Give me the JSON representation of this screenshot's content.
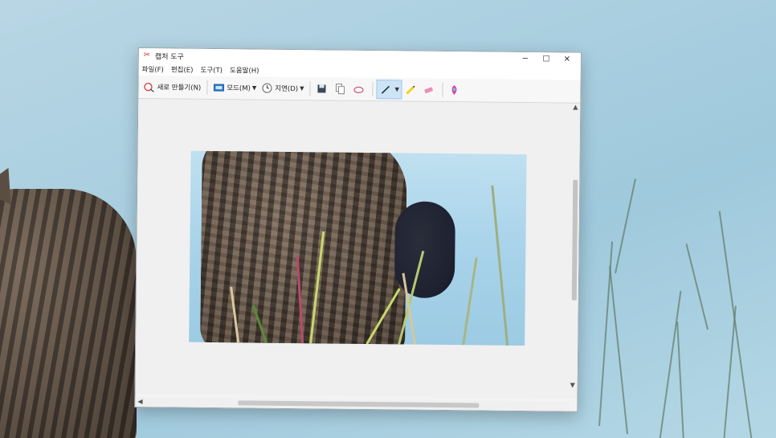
{
  "window": {
    "title": "캡처 도구",
    "controls": {
      "minimize": "─",
      "maximize": "☐",
      "close": "✕"
    }
  },
  "menu": [
    "파일(F)",
    "편집(E)",
    "도구(T)",
    "도움말(H)"
  ],
  "toolbar": {
    "new_label": "새로 만들기(N)",
    "mode_label": "모드(M)",
    "delay_label": "지연(D)"
  },
  "icons": {
    "app": "scissors-icon",
    "new": "new-snip-icon",
    "mode": "mode-icon",
    "delay": "clock-icon",
    "save": "save-icon",
    "copy": "copy-icon",
    "send": "send-icon",
    "pen": "pen-icon",
    "highlighter": "highlighter-icon",
    "eraser": "eraser-icon",
    "paint3d": "paint3d-icon"
  },
  "colors": {
    "pen_active_bg": "#cde4f7",
    "highlighter": "#f2d31a",
    "eraser": "#e88fb5",
    "paint3d": "#e0409a"
  }
}
